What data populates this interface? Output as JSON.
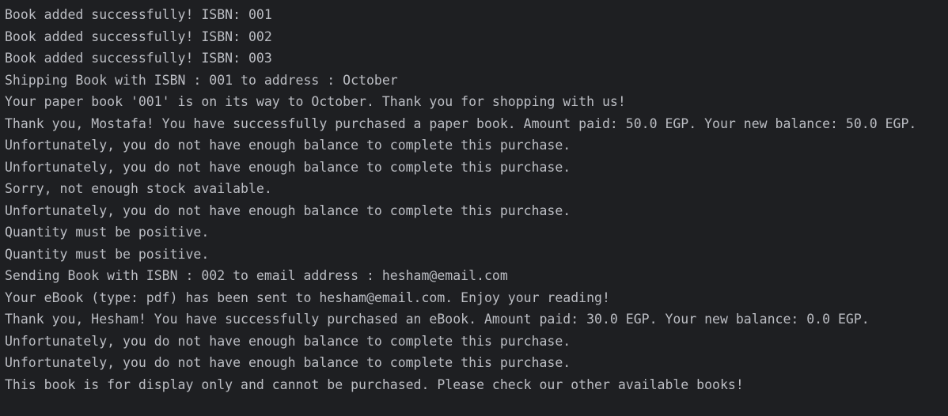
{
  "console": {
    "partial_top_line": "",
    "lines": [
      "Book added successfully! ISBN: 001",
      "Book added successfully! ISBN: 002",
      "Book added successfully! ISBN: 003",
      "Shipping Book with ISBN : 001 to address : October",
      "Your paper book '001' is on its way to October. Thank you for shopping with us!",
      "Thank you, Mostafa! You have successfully purchased a paper book. Amount paid: 50.0 EGP. Your new balance: 50.0 EGP.",
      "Unfortunately, you do not have enough balance to complete this purchase.",
      "Unfortunately, you do not have enough balance to complete this purchase.",
      "Sorry, not enough stock available.",
      "Unfortunately, you do not have enough balance to complete this purchase.",
      "Quantity must be positive.",
      "Quantity must be positive.",
      "Sending Book with ISBN : 002 to email address : hesham@email.com",
      "Your eBook (type: pdf) has been sent to hesham@email.com. Enjoy your reading!",
      "Thank you, Hesham! You have successfully purchased an eBook. Amount paid: 30.0 EGP. Your new balance: 0.0 EGP.",
      "Unfortunately, you do not have enough balance to complete this purchase.",
      "Unfortunately, you do not have enough balance to complete this purchase.",
      "This book is for display only and cannot be purchased. Please check our other available books!"
    ]
  },
  "colors": {
    "background": "#1e1f22",
    "text": "#bcbec4"
  }
}
